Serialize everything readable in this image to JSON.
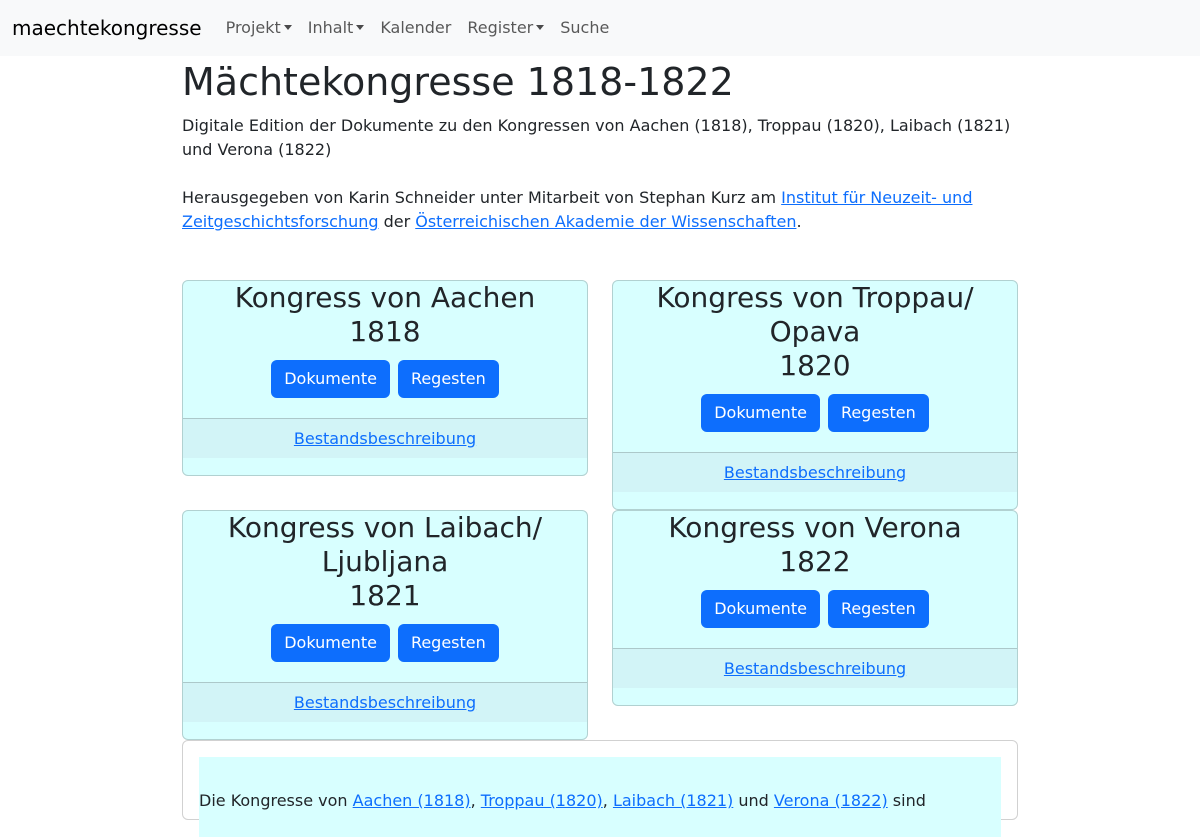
{
  "navbar": {
    "brand": "maechtekongresse",
    "items": [
      {
        "label": "Projekt",
        "dropdown": true
      },
      {
        "label": "Inhalt",
        "dropdown": true
      },
      {
        "label": "Kalender",
        "dropdown": false
      },
      {
        "label": "Register",
        "dropdown": true
      },
      {
        "label": "Suche",
        "dropdown": false
      }
    ]
  },
  "main": {
    "title": "Mächtekongresse 1818-1822",
    "intro": "Digitale Edition der Dokumente zu den Kongressen von Aachen (1818), Troppau (1820), Laibach (1821) und Verona (1822)",
    "editor_text_before": "Herausgegeben von Karin Schneider unter Mitarbeit von Stephan Kurz am ",
    "editor_link1": "Institut für Neuzeit- und Zeitgeschichtsforschung",
    "editor_text_middle": " der ",
    "editor_link2": "Österreichischen Akademie der Wissenschaften",
    "editor_text_after": "."
  },
  "cards": [
    {
      "title_line1": "Kongress von Aachen",
      "title_line2": "",
      "year": "1818",
      "btn_docs": "Dokumente",
      "btn_regesten": "Regesten",
      "footer_link": "Bestandsbeschreibung"
    },
    {
      "title_line1": "Kongress von Troppau/",
      "title_line2": "Opava",
      "year": "1820",
      "btn_docs": "Dokumente",
      "btn_regesten": "Regesten",
      "footer_link": "Bestandsbeschreibung"
    },
    {
      "title_line1": "Kongress von Laibach/",
      "title_line2": "Ljubljana",
      "year": "1821",
      "btn_docs": "Dokumente",
      "btn_regesten": "Regesten",
      "footer_link": "Bestandsbeschreibung"
    },
    {
      "title_line1": "Kongress von Verona",
      "title_line2": "",
      "year": "1822",
      "btn_docs": "Dokumente",
      "btn_regesten": "Regesten",
      "footer_link": "Bestandsbeschreibung"
    }
  ],
  "info": {
    "text_before": "Die Kongresse von ",
    "link_aachen": "Aachen (1818)",
    "sep1": ", ",
    "link_troppau": "Troppau (1820)",
    "sep2": ", ",
    "link_laibach": "Laibach (1821)",
    "text_and": " und ",
    "link_verona": "Verona (1822)",
    "text_after": " sind"
  }
}
